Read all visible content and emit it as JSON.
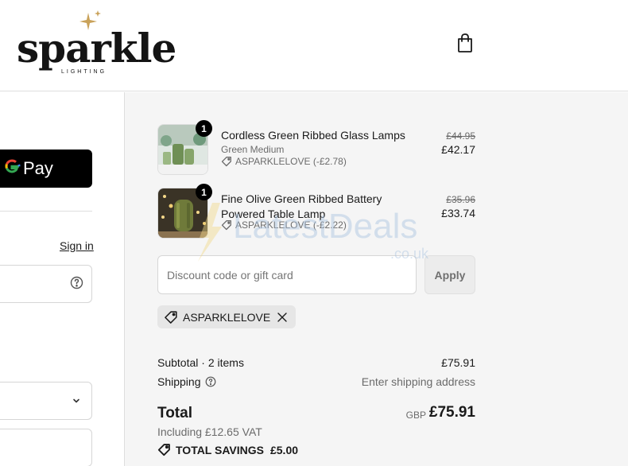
{
  "brand": {
    "name": "sparkle",
    "sub": "LIGHTING"
  },
  "left": {
    "gpay_label": "Pay",
    "gpay_g": "G",
    "signin_label": "Sign in"
  },
  "items": [
    {
      "name": "Cordless Green Ribbed Glass Lamps",
      "variant": "Green Medium",
      "discount_code": "ASPARKLELOVE (-£2.78)",
      "old_price": "£44.95",
      "price": "£42.17",
      "qty": "1"
    },
    {
      "name": "Fine Olive Green Ribbed Battery Powered Table Lamp",
      "variant": "",
      "discount_code": "ASPARKLELOVE (-£2.22)",
      "old_price": "£35.96",
      "price": "£33.74",
      "qty": "1"
    }
  ],
  "discount": {
    "placeholder": "Discount code or gift card",
    "apply_label": "Apply",
    "applied_code": "ASPARKLELOVE"
  },
  "totals": {
    "subtotal_label": "Subtotal · 2 items",
    "subtotal_value": "£75.91",
    "shipping_label": "Shipping",
    "shipping_value": "Enter shipping address",
    "total_label": "Total",
    "currency": "GBP",
    "total_value": "£75.91",
    "vat": "Including £12.65 VAT",
    "savings_label": "TOTAL SAVINGS",
    "savings_value": "£5.00"
  },
  "watermark": {
    "line1": "LatestDeals",
    "line2": ".co.uk"
  },
  "colors": {
    "accent": "#000000",
    "summary_bg": "#f5f5f5",
    "star": "#c9a25a"
  }
}
